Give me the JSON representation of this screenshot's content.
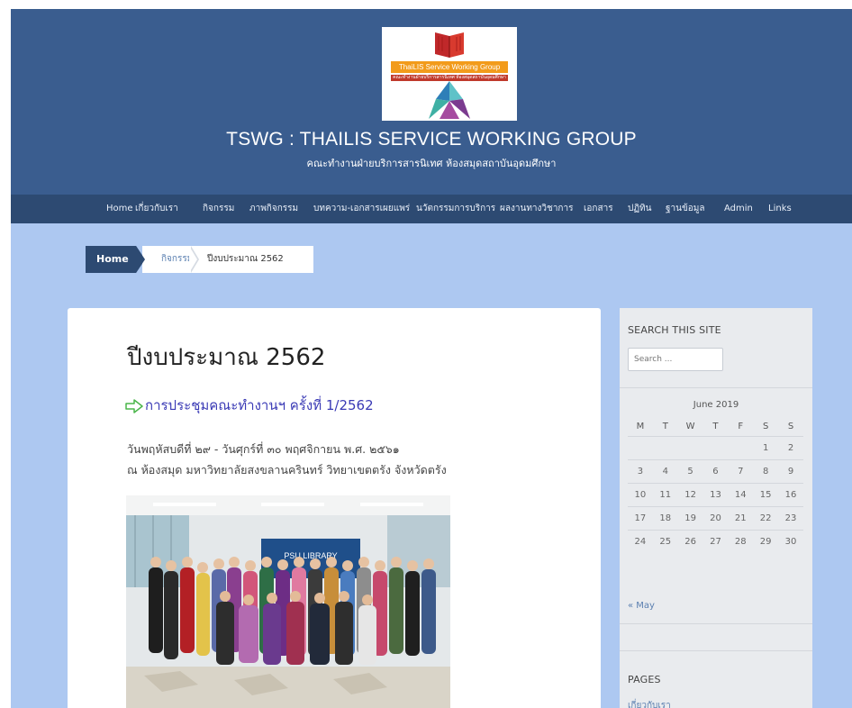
{
  "header": {
    "logo_banner": "ThaiLIS Service Working Group",
    "logo_strip": "คณะทำงานฝ่ายบริการสารนิเทศ ห้องสมุดสถาบันอุดมศึกษา",
    "site_title": "TSWG : THAILIS SERVICE WORKING GROUP",
    "tagline": "คณะทำงานฝ่ายบริการสารนิเทศ ห้องสมุดสถาบันอุดมศึกษา"
  },
  "nav": {
    "items": [
      "Home",
      "เกี่ยวกับเรา",
      "กิจกรรม",
      "ภาพกิจกรรม",
      "บทความ-เอกสารเผยแพร่",
      "นวัตกรรมการบริการ",
      "ผลงานทางวิชาการ",
      "เอกสาร",
      "ปฏิทิน",
      "ฐานข้อมูล",
      "Admin",
      "Links"
    ]
  },
  "breadcrumb": {
    "home": "Home",
    "level2": "กิจกรรม",
    "current": "ปีงบประมาณ 2562"
  },
  "post": {
    "title": "ปีงบประมาณ 2562",
    "link_text": "การประชุมคณะทำงานฯ ครั้งที่ 1/2562",
    "line1": "วันพฤหัสบดีที่ ๒๙ - วันศุกร์ที่ ๓๐ พฤศจิกายน พ.ศ. ๒๕๖๑",
    "line2": "ณ ห้องสมุด มหาวิทยาลัยสงขลานครินทร์ วิทยาเขตตรัง จังหวัดตรัง",
    "photo_banner": "PSU LIBRARY"
  },
  "sidebar": {
    "search_title": "SEARCH THIS SITE",
    "search_placeholder": "Search ...",
    "calendar_caption": "June 2019",
    "weekdays": [
      "M",
      "T",
      "W",
      "T",
      "F",
      "S",
      "S"
    ],
    "weeks": [
      [
        "",
        "",
        "",
        "",
        "",
        "1",
        "2"
      ],
      [
        "3",
        "4",
        "5",
        "6",
        "7",
        "8",
        "9"
      ],
      [
        "10",
        "11",
        "12",
        "13",
        "14",
        "15",
        "16"
      ],
      [
        "17",
        "18",
        "19",
        "20",
        "21",
        "22",
        "23"
      ],
      [
        "24",
        "25",
        "26",
        "27",
        "28",
        "29",
        "30"
      ]
    ],
    "prev_month": "« May",
    "pages_title": "PAGES",
    "pages_first": "เกี่ยวกับเรา"
  },
  "colors": {
    "header_bg": "#3a5d8f",
    "nav_bg": "#2d4a72",
    "page_bg": "#adc8f1",
    "link": "#3a3ab5"
  }
}
